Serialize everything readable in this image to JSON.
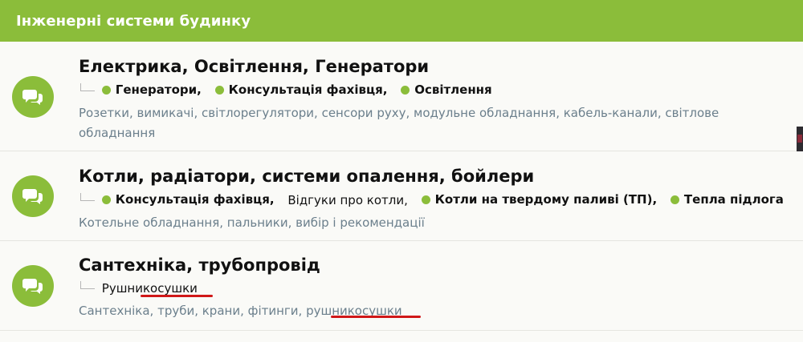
{
  "category": {
    "title": "Інженерні системи будинку"
  },
  "forums": [
    {
      "title": "Електрика, Освітлення, Генератори",
      "subforums": [
        {
          "label": "Генератори,",
          "bold": true,
          "dot": true
        },
        {
          "label": "Консультація фахівця,",
          "bold": true,
          "dot": true
        },
        {
          "label": "Освітлення",
          "bold": true,
          "dot": true
        }
      ],
      "description": "Розетки, вимикачі, світлорегулятори, сенсори руху, модульне обладнання, кабель-канали, світлове обладнання"
    },
    {
      "title": "Котли, радіатори, системи опалення, бойлери",
      "subforums": [
        {
          "label": "Консультація фахівця,",
          "bold": true,
          "dot": true
        },
        {
          "label": "Відгуки про котли,",
          "bold": false,
          "dot": false
        },
        {
          "label": "Котли на твердому паливі (ТП),",
          "bold": true,
          "dot": true
        },
        {
          "label": "Тепла підлога",
          "bold": true,
          "dot": true
        }
      ],
      "description": "Котельне обладнання, пальники, вибір і рекомендації"
    },
    {
      "title": "Сантехніка, трубопровід",
      "subforums": [
        {
          "label": "Рушникосушки",
          "bold": false,
          "dot": false
        }
      ],
      "description": "Сантехніка, труби, крани, фітинги, рушникосушки"
    }
  ],
  "colors": {
    "accent": "#8bbd3a",
    "description_text": "#6b7f8c",
    "annotation_underline": "#d01818"
  },
  "icons": {
    "forum_icon": "chat-bubbles-icon"
  }
}
